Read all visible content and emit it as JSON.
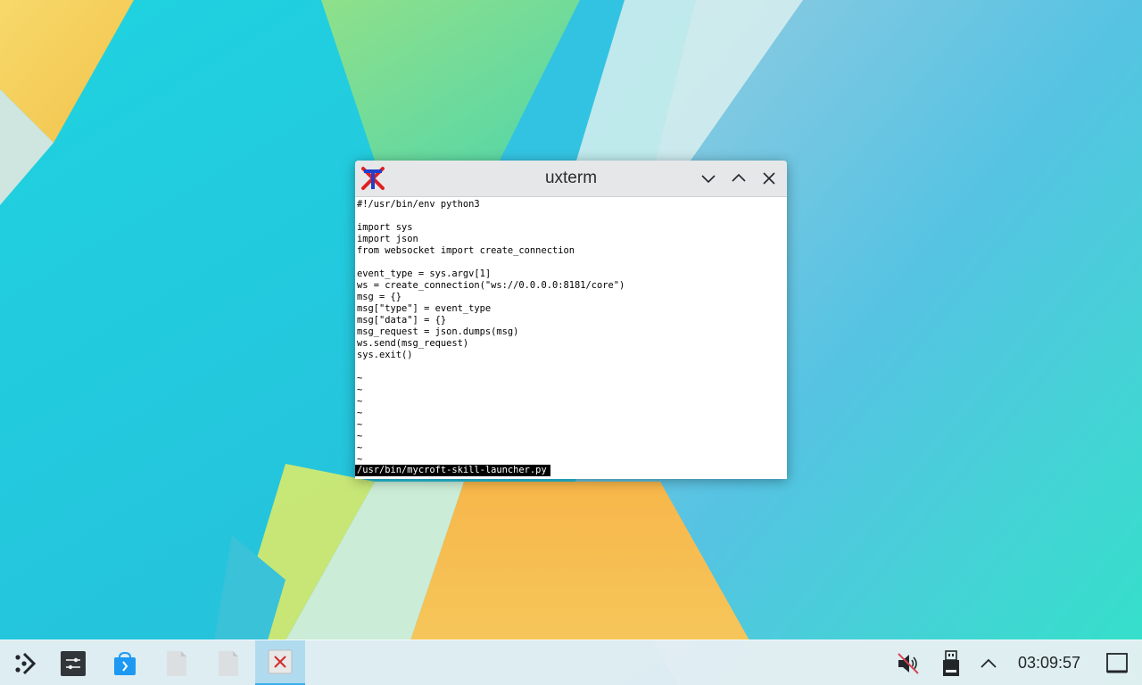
{
  "window": {
    "title": "uxterm",
    "app_icon": "xterm-icon"
  },
  "terminal": {
    "lines": [
      "#!/usr/bin/env python3",
      "",
      "import sys",
      "import json",
      "from websocket import create_connection",
      "",
      "event_type = sys.argv[1]",
      "ws = create_connection(\"ws://0.0.0.0:8181/core\")",
      "msg = {}",
      "msg[\"type\"] = event_type",
      "msg[\"data\"] = {}",
      "msg_request = json.dumps(msg)",
      "ws.send(msg_request)",
      "sys.exit()",
      "",
      "~",
      "~",
      "~",
      "~",
      "~",
      "~",
      "~",
      "~"
    ],
    "status_line": "/usr/bin/mycroft-skill-launcher.py"
  },
  "taskbar": {
    "launcher_icon": "application-launcher-icon",
    "tasks": [
      {
        "icon": "system-settings-icon"
      },
      {
        "icon": "discover-store-icon"
      },
      {
        "icon": "document-icon"
      },
      {
        "icon": "document-icon"
      },
      {
        "icon": "xterm-icon",
        "active": true
      }
    ],
    "tray": {
      "volume_icon": "volume-muted-icon",
      "usb_icon": "removable-device-icon",
      "expand_icon": "chevron-up-icon"
    },
    "clock": "03:09:57",
    "show_desktop_icon": "show-desktop-icon"
  },
  "colors": {
    "accent": "#3daee9",
    "terminal_bg": "#ffffff",
    "titlebar": "#e6e7e9"
  }
}
